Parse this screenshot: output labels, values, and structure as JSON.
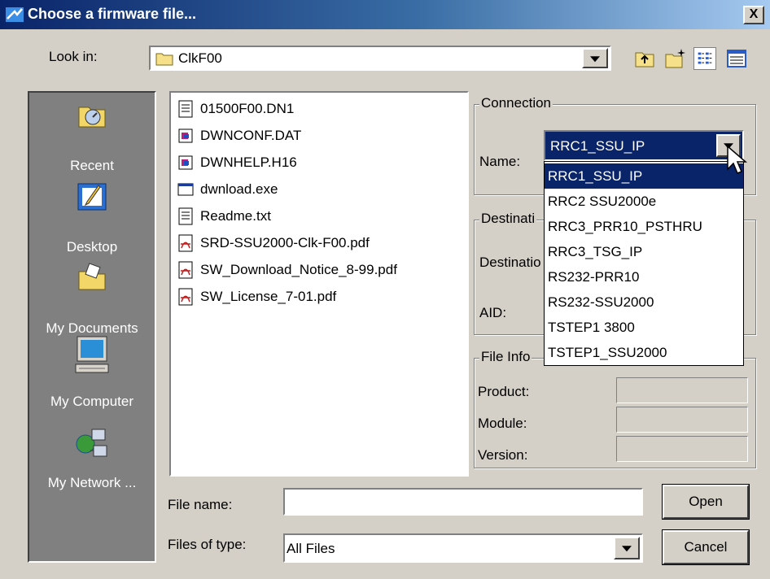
{
  "window": {
    "title": "Choose a firmware file...",
    "close_glyph": "X"
  },
  "lookin": {
    "label": "Look in:",
    "value": "ClkF00"
  },
  "places": [
    {
      "label": "Recent",
      "icon": "recent-icon"
    },
    {
      "label": "Desktop",
      "icon": "desktop-icon"
    },
    {
      "label": "My Documents",
      "icon": "my-documents-icon"
    },
    {
      "label": "My Computer",
      "icon": "my-computer-icon"
    },
    {
      "label": "My Network ...",
      "icon": "my-network-icon"
    }
  ],
  "files": [
    {
      "name": "01500F00.DN1",
      "icon": "text-file-icon"
    },
    {
      "name": "DWNCONF.DAT",
      "icon": "data-file-icon"
    },
    {
      "name": "DWNHELP.H16",
      "icon": "data-file-icon"
    },
    {
      "name": "dwnload.exe",
      "icon": "exe-file-icon"
    },
    {
      "name": "Readme.txt",
      "icon": "text-file-icon"
    },
    {
      "name": "SRD-SSU2000-Clk-F00.pdf",
      "icon": "pdf-file-icon"
    },
    {
      "name": "SW_Download_Notice_8-99.pdf",
      "icon": "pdf-file-icon"
    },
    {
      "name": "SW_License_7-01.pdf",
      "icon": "pdf-file-icon"
    }
  ],
  "connection": {
    "legend": "Connection",
    "name_label": "Name:",
    "name_value": "RRC1_SSU_IP",
    "options": [
      "RRC1_SSU_IP",
      "RRC2 SSU2000e",
      "RRC3_PRR10_PSTHRU",
      "RRC3_TSG_IP",
      "RS232-PRR10",
      "RS232-SSU2000",
      "TSTEP1 3800",
      "TSTEP1_SSU2000"
    ]
  },
  "destination": {
    "legend": "Destinati",
    "destination_label": "Destinatio",
    "aid_label": "AID:"
  },
  "file_info": {
    "legend": "File Info",
    "product_label": "Product:",
    "module_label": "Module:",
    "version_label": "Version:"
  },
  "filename": {
    "label": "File name:",
    "value": ""
  },
  "filetype": {
    "label": "Files of type:",
    "value": "All Files"
  },
  "buttons": {
    "open": "Open",
    "cancel": "Cancel"
  },
  "colors": {
    "title_start": "#0a246a",
    "title_end": "#a6caf0",
    "selection": "#0a246a",
    "face": "#d4d0c8"
  }
}
